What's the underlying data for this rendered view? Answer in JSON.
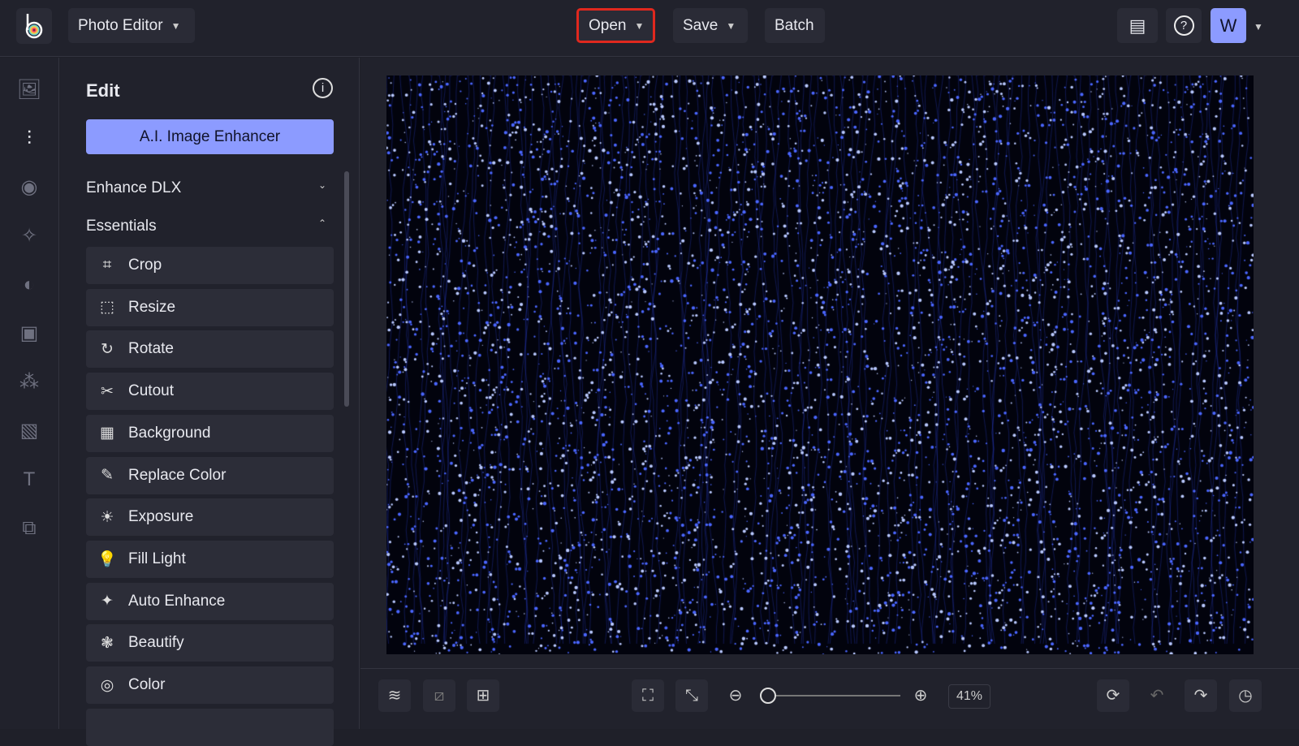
{
  "header": {
    "app_menu": "Photo Editor",
    "open": "Open",
    "save": "Save",
    "batch": "Batch",
    "avatar": "W"
  },
  "panel": {
    "title": "Edit",
    "ai_button": "A.I. Image Enhancer",
    "sections": [
      {
        "label": "Enhance DLX",
        "state": "collapsed"
      },
      {
        "label": "Essentials",
        "state": "expanded"
      }
    ],
    "tools": [
      {
        "label": "Crop",
        "icon": "crop-icon",
        "glyph": "⌗"
      },
      {
        "label": "Resize",
        "icon": "resize-icon",
        "glyph": "⬚"
      },
      {
        "label": "Rotate",
        "icon": "rotate-icon",
        "glyph": "↻"
      },
      {
        "label": "Cutout",
        "icon": "scissors-icon",
        "glyph": "✂"
      },
      {
        "label": "Background",
        "icon": "checkerboard-icon",
        "glyph": "▦"
      },
      {
        "label": "Replace Color",
        "icon": "eyedropper-icon",
        "glyph": "✎"
      },
      {
        "label": "Exposure",
        "icon": "exposure-icon",
        "glyph": "☀"
      },
      {
        "label": "Fill Light",
        "icon": "lightbulb-icon",
        "glyph": "💡"
      },
      {
        "label": "Auto Enhance",
        "icon": "magic-wand-icon",
        "glyph": "✦"
      },
      {
        "label": "Beautify",
        "icon": "flower-icon",
        "glyph": "❃"
      },
      {
        "label": "Color",
        "icon": "color-wheel-icon",
        "glyph": "◎"
      }
    ]
  },
  "footer": {
    "zoom": "41%",
    "zoom_fraction": 0.1
  },
  "colors": {
    "accent": "#8c9bff",
    "highlight": "#e0281e",
    "lights": "#3d5cff"
  }
}
